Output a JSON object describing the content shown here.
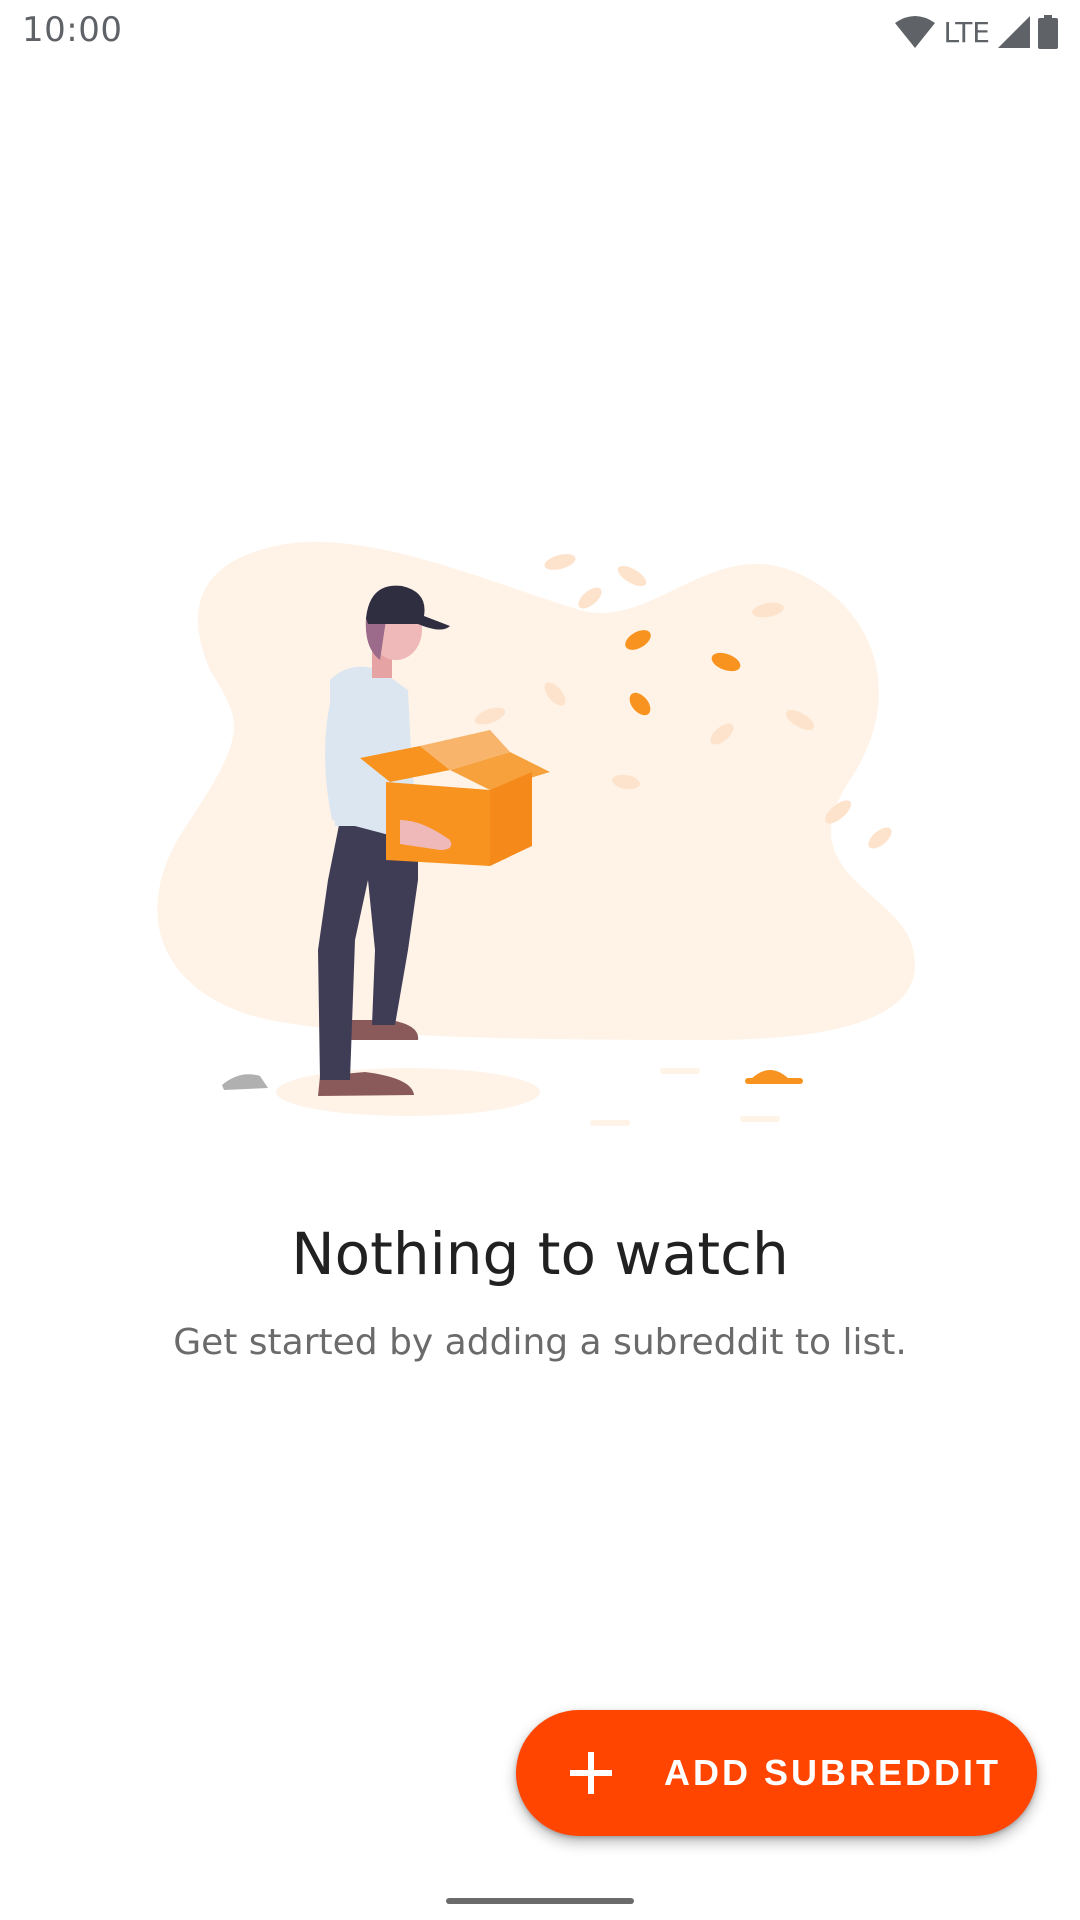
{
  "status_bar": {
    "time": "10:00",
    "network": "LTE",
    "icons": [
      "wifi-icon",
      "cell-signal-icon",
      "battery-icon"
    ]
  },
  "illustration": {
    "name": "person-holding-box-illustration",
    "colors": {
      "blob": "#fff3e8",
      "box": "#f7931e",
      "leaf": "#f7931e",
      "shirt": "#dce6f0",
      "pants": "#3f3d56",
      "cap": "#2f2e41",
      "shoes": "#8a5a5a"
    }
  },
  "empty_state": {
    "title": "Nothing to watch",
    "subtitle": "Get started by adding a subreddit to list."
  },
  "fab": {
    "icon": "plus-icon",
    "label": "ADD SUBREDDIT",
    "color": "#ff4500"
  }
}
